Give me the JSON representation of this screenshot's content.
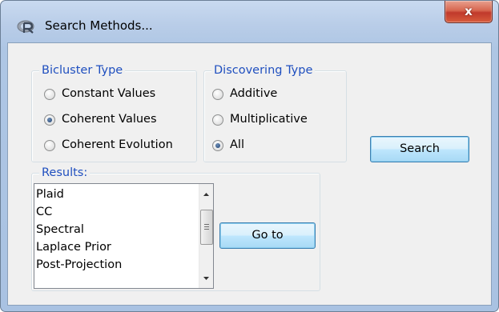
{
  "window": {
    "title": "Search Methods...",
    "close_glyph": "x",
    "icon": "r-logo-icon"
  },
  "bicluster_type": {
    "title": "Bicluster Type",
    "options": [
      {
        "label": "Constant Values",
        "checked": false
      },
      {
        "label": "Coherent Values",
        "checked": true
      },
      {
        "label": "Coherent Evolution",
        "checked": false
      }
    ]
  },
  "discovering_type": {
    "title": "Discovering Type",
    "options": [
      {
        "label": "Additive",
        "checked": false
      },
      {
        "label": "Multiplicative",
        "checked": false
      },
      {
        "label": "All",
        "checked": true
      }
    ]
  },
  "search_button": {
    "label": "Search"
  },
  "results": {
    "title": "Results:",
    "items": [
      "Plaid",
      "CC",
      "Spectral",
      "Laplace Prior",
      "Post-Projection"
    ]
  },
  "goto_button": {
    "label": "Go to"
  },
  "colors": {
    "group_title": "#1f4fbf",
    "close_button": "#c0392b",
    "focused_button_border": "#3c7fb1"
  }
}
